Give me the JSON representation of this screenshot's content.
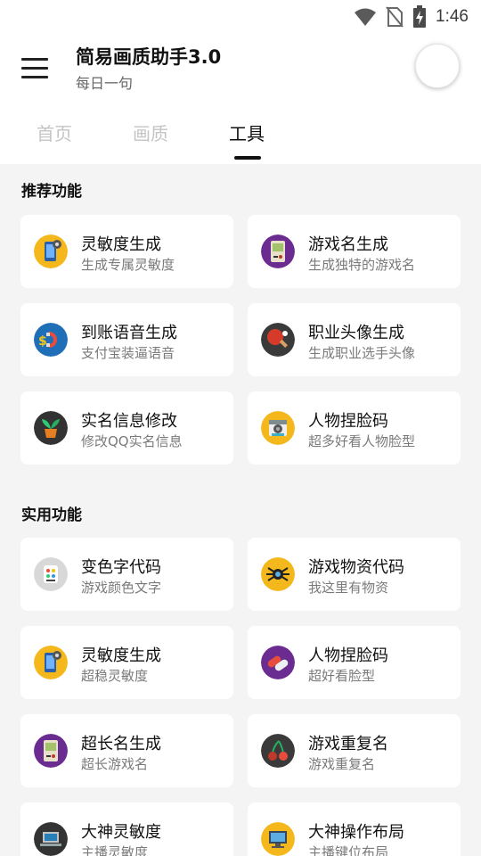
{
  "status_bar": {
    "time": "1:46",
    "icons": [
      "wifi-icon",
      "no-sim-icon",
      "battery-charging-icon"
    ]
  },
  "header": {
    "title": "简易画质助手3.0",
    "subtitle": "每日一句",
    "menu_icon": "hamburger-menu-icon",
    "avatar": "avatar"
  },
  "tabs": [
    {
      "label": "首页",
      "active": false
    },
    {
      "label": "画质",
      "active": false
    },
    {
      "label": "工具",
      "active": true
    }
  ],
  "sections": [
    {
      "title": "推荐功能",
      "items": [
        {
          "title": "灵敏度生成",
          "subtitle": "生成专属灵敏度",
          "icon": "phone-gear-icon"
        },
        {
          "title": "游戏名生成",
          "subtitle": "生成独特的游戏名",
          "icon": "gameboy-icon"
        },
        {
          "title": "到账语音生成",
          "subtitle": "支付宝装逼语音",
          "icon": "money-magnet-icon"
        },
        {
          "title": "职业头像生成",
          "subtitle": "生成职业选手头像",
          "icon": "ping-pong-icon"
        },
        {
          "title": "实名信息修改",
          "subtitle": "修改QQ实名信息",
          "icon": "plant-pot-icon"
        },
        {
          "title": "人物捏脸码",
          "subtitle": "超多好看人物脸型",
          "icon": "camera-icon"
        }
      ]
    },
    {
      "title": "实用功能",
      "items": [
        {
          "title": "变色字代码",
          "subtitle": "游戏颜色文字",
          "icon": "color-palette-icon"
        },
        {
          "title": "游戏物资代码",
          "subtitle": "我这里有物资",
          "icon": "spider-icon"
        },
        {
          "title": "灵敏度生成",
          "subtitle": "超稳灵敏度",
          "icon": "phone-gear-icon"
        },
        {
          "title": "人物捏脸码",
          "subtitle": "超好看脸型",
          "icon": "pills-icon"
        },
        {
          "title": "超长名生成",
          "subtitle": "超长游戏名",
          "icon": "gameboy-icon"
        },
        {
          "title": "游戏重复名",
          "subtitle": "游戏重复名",
          "icon": "cherry-icon"
        },
        {
          "title": "大神灵敏度",
          "subtitle": "主播灵敏度",
          "icon": "laptop-icon"
        },
        {
          "title": "大神操作布局",
          "subtitle": "主播键位布局",
          "icon": "monitor-icon"
        }
      ]
    }
  ]
}
